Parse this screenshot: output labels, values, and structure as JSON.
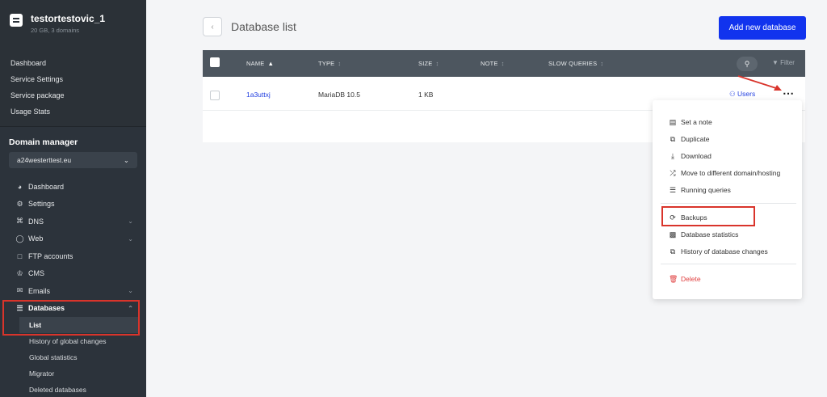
{
  "account": {
    "name": "testortestovic_1",
    "subtitle": "20 GB, 3 domains"
  },
  "top_nav": [
    "Dashboard",
    "Service Settings",
    "Service package",
    "Usage Stats"
  ],
  "domain_manager": {
    "title": "Domain manager",
    "selected_domain": "a24westerttest.eu",
    "items": [
      {
        "label": "Dashboard",
        "icon": "dashboard-icon",
        "has_chevron": false
      },
      {
        "label": "Settings",
        "icon": "gear-icon",
        "has_chevron": false
      },
      {
        "label": "DNS",
        "icon": "dns-icon",
        "has_chevron": true
      },
      {
        "label": "Web",
        "icon": "globe-icon",
        "has_chevron": true
      },
      {
        "label": "FTP accounts",
        "icon": "folder-icon",
        "has_chevron": false
      },
      {
        "label": "CMS",
        "icon": "cms-icon",
        "has_chevron": false
      },
      {
        "label": "Emails",
        "icon": "envelope-icon",
        "has_chevron": true
      },
      {
        "label": "Databases",
        "icon": "database-icon",
        "has_chevron": true
      }
    ],
    "database_subitems": [
      "List",
      "History of global changes",
      "Global statistics",
      "Migrator",
      "Deleted databases"
    ]
  },
  "main": {
    "title": "Database list",
    "add_button": "Add new database",
    "table": {
      "headers": [
        "NAME",
        "TYPE",
        "SIZE",
        "NOTE",
        "SLOW QUERIES"
      ],
      "filter_label": "Filter",
      "rows": [
        {
          "name": "1a3uttxj",
          "type": "MariaDB 10.5",
          "size": "1 KB",
          "note": "",
          "slow_queries": "",
          "users_label": "Users"
        }
      ]
    }
  },
  "dropdown": {
    "group1": [
      {
        "label": "Set a note",
        "icon": "note-icon"
      },
      {
        "label": "Duplicate",
        "icon": "duplicate-icon"
      },
      {
        "label": "Download",
        "icon": "download-icon"
      },
      {
        "label": "Move to different domain/hosting",
        "icon": "shuffle-icon"
      },
      {
        "label": "Running queries",
        "icon": "database-icon"
      }
    ],
    "group2": [
      {
        "label": "Backups",
        "icon": "history-icon"
      },
      {
        "label": "Database statistics",
        "icon": "chart-icon"
      },
      {
        "label": "History of database changes",
        "icon": "copy-icon"
      }
    ],
    "delete_label": "Delete"
  },
  "colors": {
    "sidebar": "#2c333b",
    "accent": "#1133ee",
    "highlight": "#d9342b",
    "danger": "#e04040"
  }
}
